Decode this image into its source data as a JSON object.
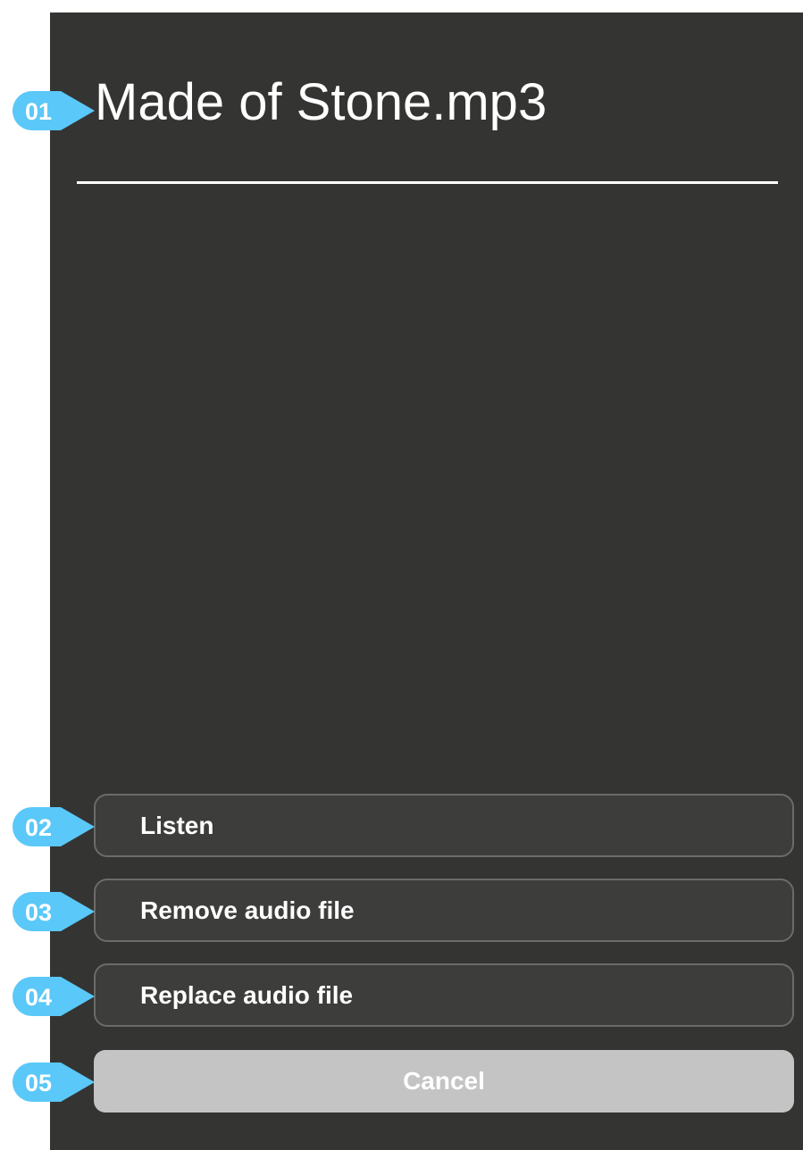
{
  "dialog": {
    "title": "Made of Stone.mp3"
  },
  "actions": [
    {
      "label": "Listen"
    },
    {
      "label": "Remove audio file"
    },
    {
      "label": "Replace audio file"
    }
  ],
  "cancel": {
    "label": "Cancel"
  },
  "callouts": [
    "01",
    "02",
    "03",
    "04",
    "05"
  ],
  "colors": {
    "background": "#343432",
    "button_fill": "#3d3d3b",
    "button_border": "#6b6b69",
    "cancel_fill": "#c4c4c4",
    "callout": "#5ac8f8",
    "text": "#ffffff"
  }
}
